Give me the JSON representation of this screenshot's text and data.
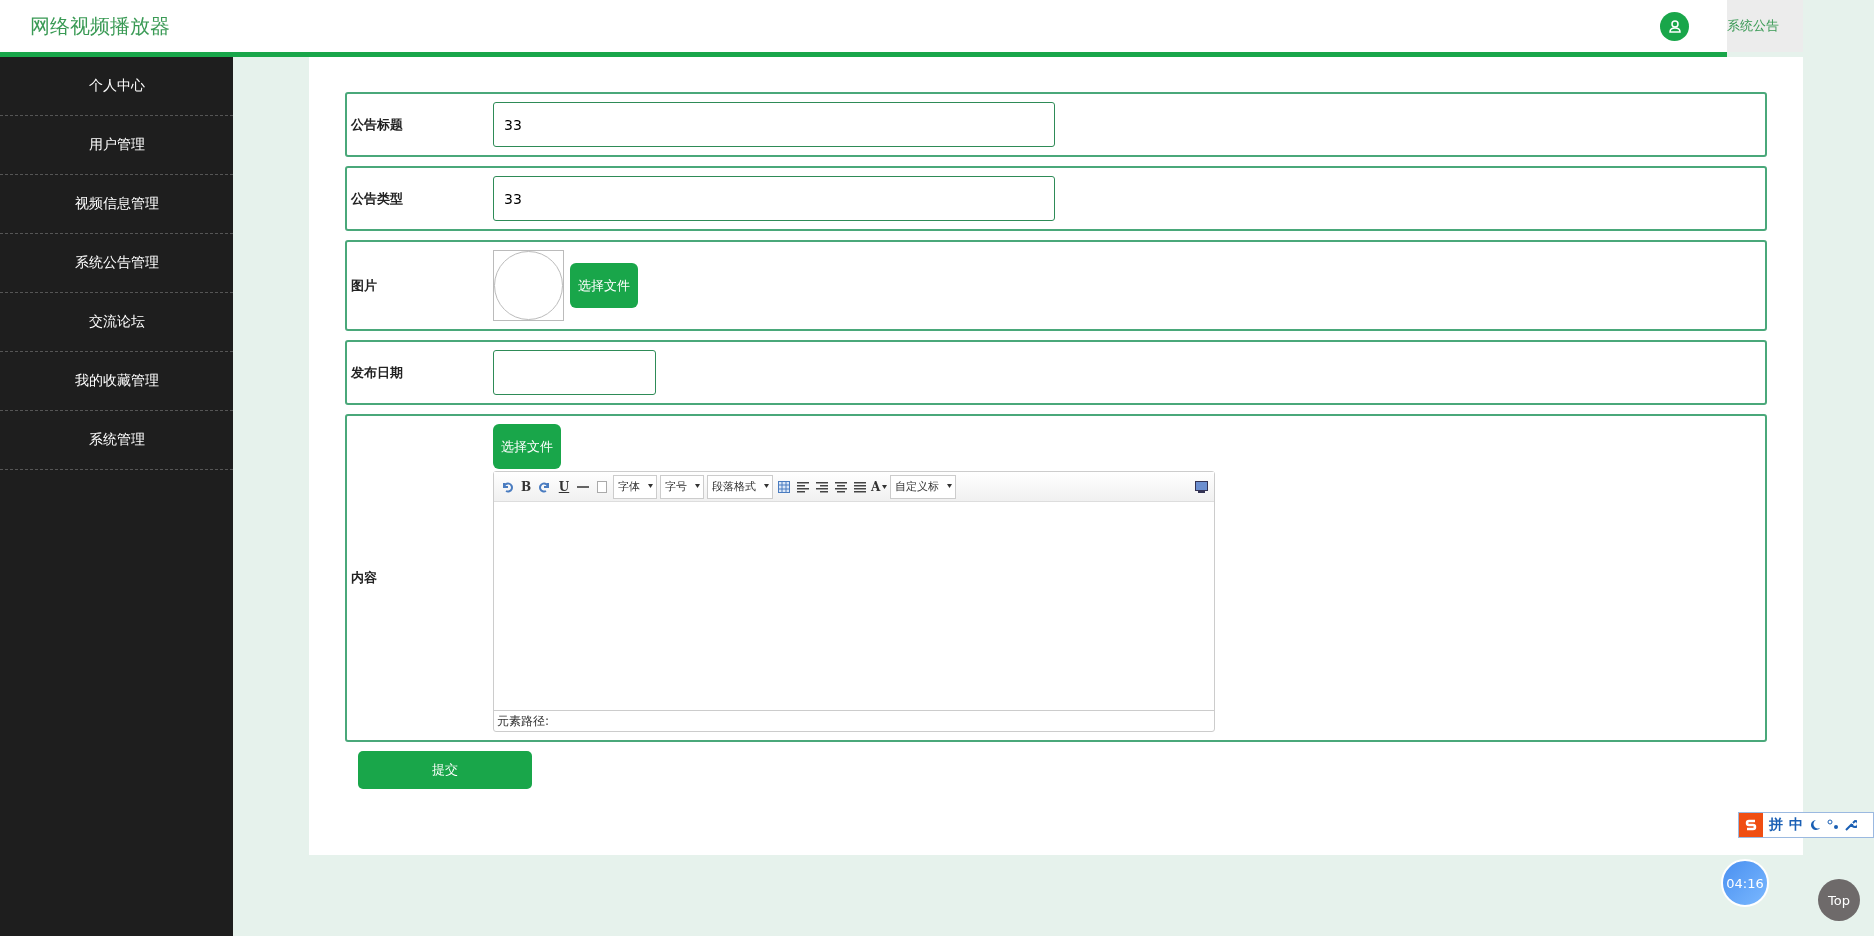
{
  "header": {
    "title": "网络视频播放器",
    "nav_tab": "系统公告"
  },
  "sidebar": {
    "items": [
      "个人中心",
      "用户管理",
      "视频信息管理",
      "系统公告管理",
      "交流论坛",
      "我的收藏管理",
      "系统管理"
    ]
  },
  "form": {
    "fields": [
      {
        "kind": "text",
        "label": "公告标题",
        "value": "33"
      },
      {
        "kind": "text",
        "label": "公告类型",
        "value": "33"
      },
      {
        "kind": "image",
        "label": "图片",
        "button": "选择文件"
      },
      {
        "kind": "date",
        "label": "发布日期"
      },
      {
        "kind": "editor",
        "label": "内容",
        "button": "选择文件",
        "toolbar": [
          {
            "kind": "undo"
          },
          {
            "kind": "glyph",
            "text": "B"
          },
          {
            "kind": "redo"
          },
          {
            "kind": "underline",
            "text": "U"
          },
          {
            "kind": "rule"
          },
          {
            "kind": "page"
          },
          {
            "kind": "select",
            "text": "字体"
          },
          {
            "kind": "select",
            "text": "字号"
          },
          {
            "kind": "select",
            "text": "段落格式"
          },
          {
            "kind": "table"
          },
          {
            "kind": "align-left"
          },
          {
            "kind": "align-right"
          },
          {
            "kind": "align-center"
          },
          {
            "kind": "justify"
          },
          {
            "kind": "color",
            "text": "A"
          },
          {
            "kind": "select",
            "text": "自定义标"
          },
          {
            "kind": "spacer"
          },
          {
            "kind": "preview"
          }
        ],
        "path_label": "元素路径:"
      }
    ],
    "submit": "提交"
  },
  "ime": {
    "items": [
      "拼",
      "中"
    ]
  },
  "timer": "04:16",
  "top_button": "Top"
}
